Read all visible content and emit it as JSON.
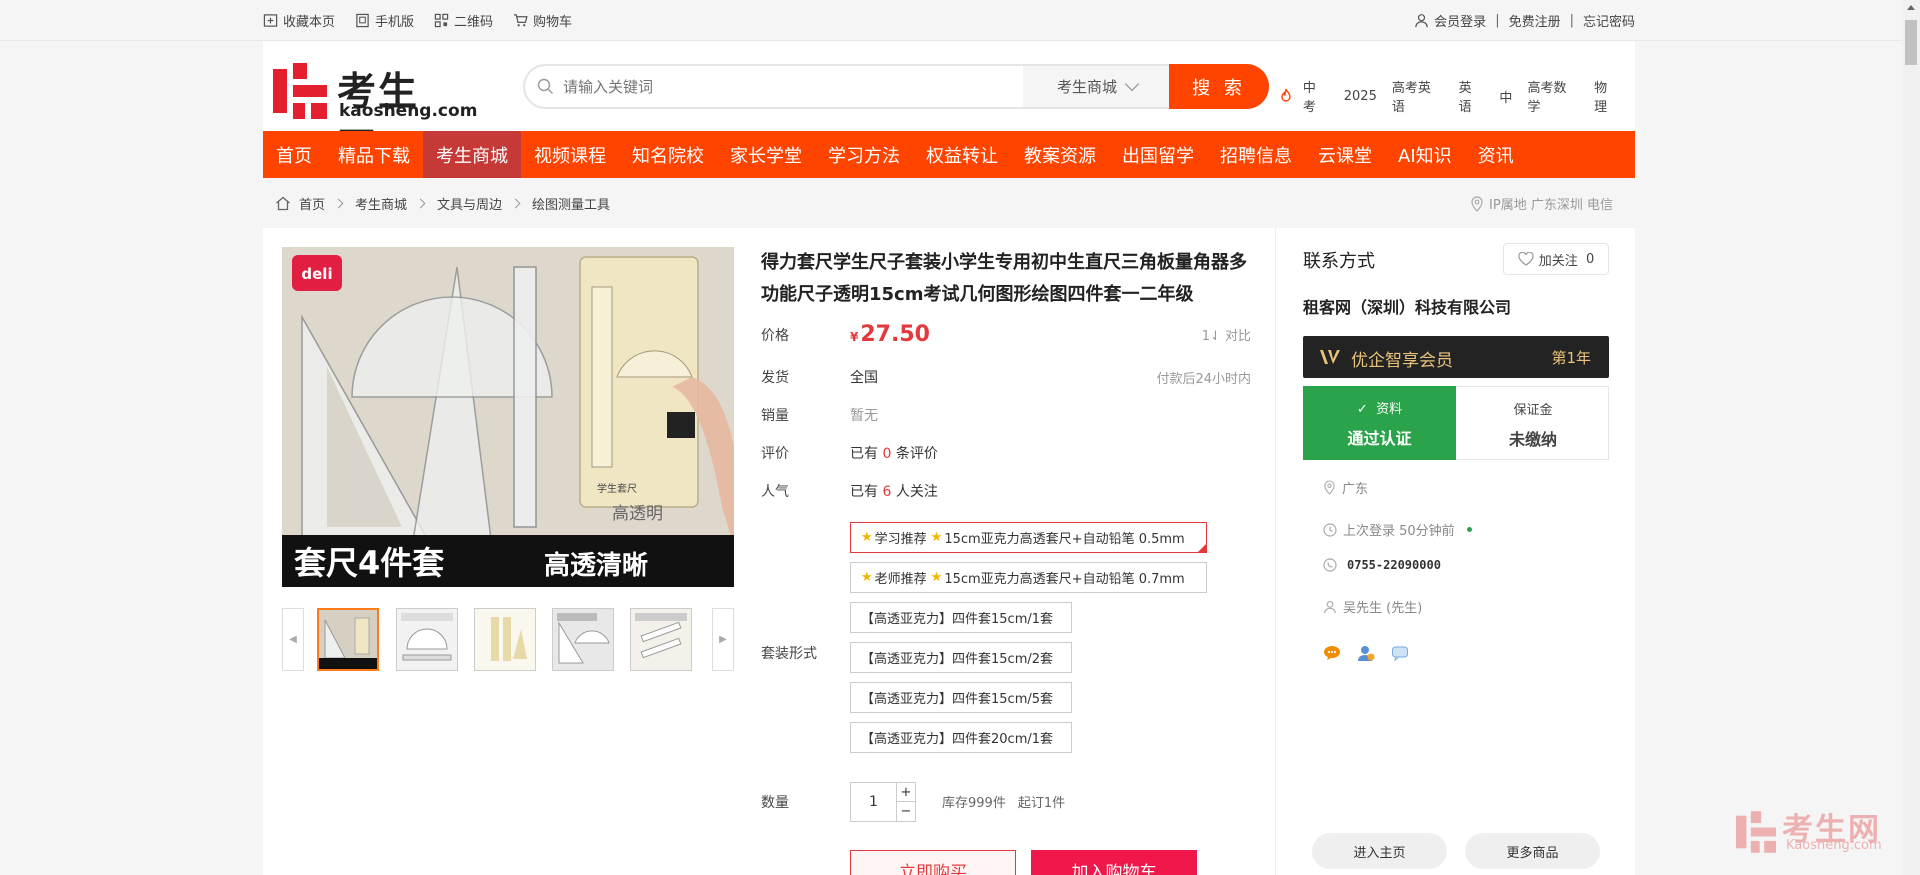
{
  "topbar": {
    "favorite": "收藏本页",
    "mobile": "手机版",
    "qrcode": "二维码",
    "cart": "购物车",
    "login": "会员登录",
    "register": "免费注册",
    "forgot": "忘记密码"
  },
  "logo": {
    "cn": "考生网",
    "en": "kaosheng.com"
  },
  "search": {
    "placeholder": "请输入关键词",
    "category": "考生商城",
    "button": "搜 索",
    "hotwords": [
      "中考",
      "2025",
      "高考英语",
      "英语",
      "中",
      "高考数学",
      "物理"
    ]
  },
  "nav": [
    "首页",
    "精品下载",
    "考生商城",
    "视频课程",
    "知名院校",
    "家长学堂",
    "学习方法",
    "权益转让",
    "教案资源",
    "出国留学",
    "招聘信息",
    "云课堂",
    "AI知识",
    "资讯"
  ],
  "nav_active": "考生商城",
  "breadcrumb": {
    "items": [
      "首页",
      "考生商城",
      "文具与周边",
      "绘图测量工具"
    ],
    "ip": "IP属地 广东深圳 电信"
  },
  "gallery": {
    "brand": "deli",
    "banner_left": "套尺4件套",
    "banner_right": "高透清晰",
    "pack_text": "学生套尺",
    "pack_sub": "高透明"
  },
  "product": {
    "title": "得力套尺学生尺子套装小学生专用初中生直尺三角板量角器多功能尺子透明15cm考试几何图形绘图四件套一二年级",
    "price_label": "价格",
    "currency": "¥",
    "price": "27.50",
    "compare": "1⇃ 对比",
    "ship_label": "发货",
    "ship_value": "全国",
    "ship_note": "付款后24小时内",
    "sales_label": "销量",
    "sales_value": "暂无",
    "review_label": "评价",
    "review_pre": "已有",
    "review_count": "0",
    "review_post": "条评价",
    "pop_label": "人气",
    "pop_pre": "已有",
    "pop_count": "6",
    "pop_post": "人关注",
    "pack_label": "套装形式",
    "options": [
      {
        "tag1": "学习推荐",
        "tag2": "15cm亚克力高透套尺+自动铅笔 0.5mm"
      },
      {
        "tag1": "老师推荐",
        "tag2": "15cm亚克力高透套尺+自动铅笔 0.7mm"
      },
      {
        "text": "【高透亚克力】四件套15cm/1套"
      },
      {
        "text": "【高透亚克力】四件套15cm/2套"
      },
      {
        "text": "【高透亚克力】四件套15cm/5套"
      },
      {
        "text": "【高透亚克力】四件套20cm/1套"
      }
    ],
    "qty_label": "数量",
    "qty_value": "1",
    "stock": "库存999件",
    "min_order": "起订1件",
    "buy_now": "立即购买",
    "add_cart": "加入购物车"
  },
  "seller": {
    "heading": "联系方式",
    "follow": "加关注",
    "follow_count": "0",
    "company": "租客网（深圳）科技有限公司",
    "vip_name": "优企智享会员",
    "vip_year": "第1年",
    "cert_label": "资料",
    "cert_status": "通过认证",
    "deposit_label": "保证金",
    "deposit_status": "未缴纳",
    "location": "广东",
    "last_login": "上次登录 50分钟前",
    "phone": "0755-22090000",
    "contact": "吴先生 (先生)",
    "home_btn": "进入主页",
    "more_btn": "更多商品"
  },
  "watermark": {
    "cn": "考生网",
    "en": "Kaosheng.com"
  },
  "colors": {
    "accent": "#ff4400",
    "nav_active": "#c53a36",
    "price": "#e4393c",
    "cert": "#2ba34a"
  }
}
